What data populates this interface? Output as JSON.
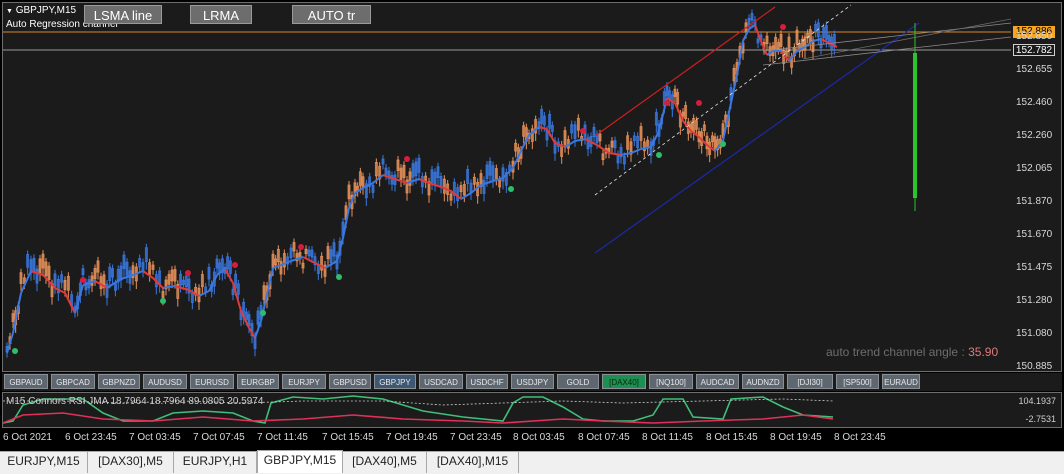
{
  "chart": {
    "symbol_label": "GBPJPY,M15",
    "indicator_label": "Auto Regression channel",
    "menu_marker": "▼",
    "buttons": [
      "LSMA line",
      "LRMA",
      "AUTO tr"
    ],
    "current_price": "152.886",
    "price_marker2": "152.782",
    "price_levels": [
      "152.850",
      "152.655",
      "152.460",
      "152.260",
      "152.065",
      "151.870",
      "151.670",
      "151.475",
      "151.280",
      "151.080",
      "150.885"
    ],
    "angle_label": "auto trend channel angle :",
    "angle_value": "35.90",
    "colors": {
      "bull": "#3a78e0",
      "bear": "#e03a3a",
      "channel_red": "#cc1f1f",
      "channel_blue": "#1a2aa8",
      "dot_red": "#d81c3c",
      "dot_green": "#2cbf6a",
      "spike": "#2bc42b"
    }
  },
  "symbols": [
    {
      "label": "GBPAUD"
    },
    {
      "label": "GBPCAD"
    },
    {
      "label": "GBPNZD"
    },
    {
      "label": "AUDUSD"
    },
    {
      "label": "EURUSD"
    },
    {
      "label": "EURGBP"
    },
    {
      "label": "EURJPY"
    },
    {
      "label": "GBPUSD"
    },
    {
      "label": "GBPJPY",
      "state": "active"
    },
    {
      "label": "USDCAD"
    },
    {
      "label": "USDCHF"
    },
    {
      "label": "USDJPY"
    },
    {
      "label": "GOLD"
    },
    {
      "label": "[DAX40]",
      "state": "green"
    },
    {
      "label": "[NQ100]"
    },
    {
      "label": "AUDCAD"
    },
    {
      "label": "AUDNZD"
    },
    {
      "label": "[DJI30]"
    },
    {
      "label": "[SP500]"
    },
    {
      "label": "EURAUD"
    }
  ],
  "indicator": {
    "title": "M15 Connors RSI JMA 18.7964 18.7964 89.0805 20.5974",
    "value_top": "104.1937",
    "value_bottom": "-2.7531"
  },
  "time_labels": [
    "6 Oct 2021",
    "6 Oct 23:45",
    "7 Oct 03:45",
    "7 Oct 07:45",
    "7 Oct 11:45",
    "7 Oct 15:45",
    "7 Oct 19:45",
    "7 Oct 23:45",
    "8 Oct 03:45",
    "8 Oct 07:45",
    "8 Oct 11:45",
    "8 Oct 15:45",
    "8 Oct 19:45",
    "8 Oct 23:45"
  ],
  "tabs": [
    {
      "label": "EURJPY,M15"
    },
    {
      "label": "[DAX30],M5"
    },
    {
      "label": "EURJPY,H1"
    },
    {
      "label": "GBPJPY,M15",
      "active": true
    },
    {
      "label": "[DAX40],M5"
    },
    {
      "label": "[DAX40],M15"
    }
  ]
}
